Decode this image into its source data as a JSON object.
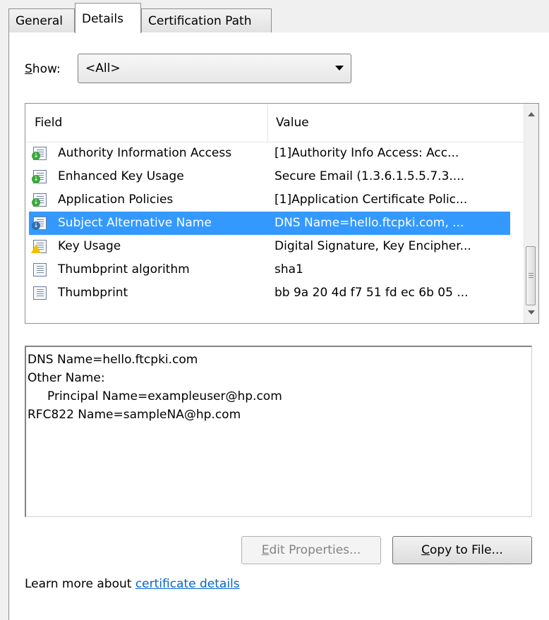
{
  "tabs": {
    "general": "General",
    "details": "Details",
    "cert_path": "Certification Path"
  },
  "show": {
    "label_underlined": "S",
    "label_rest": "how:",
    "selected": "<All>"
  },
  "list": {
    "col_field": "Field",
    "col_value": "Value",
    "rows": [
      {
        "field": "Authority Information Access",
        "value": "[1]Authority Info Access: Acc...",
        "icon": "certificate-extension-icon"
      },
      {
        "field": "Enhanced Key Usage",
        "value": "Secure Email (1.3.6.1.5.5.7.3....",
        "icon": "certificate-extension-icon"
      },
      {
        "field": "Application Policies",
        "value": "[1]Application Certificate Polic...",
        "icon": "certificate-extension-icon"
      },
      {
        "field": "Subject Alternative Name",
        "value": "DNS Name=hello.ftcpki.com, ...",
        "icon": "certificate-extension-icon"
      },
      {
        "field": "Key Usage",
        "value": "Digital Signature, Key Encipher...",
        "icon": "critical-extension-warning-icon"
      },
      {
        "field": "Thumbprint algorithm",
        "value": "sha1",
        "icon": "property-icon"
      },
      {
        "field": "Thumbprint",
        "value": "bb 9a 20 4d f7 51 fd ec 6b 05 ...",
        "icon": "property-icon"
      }
    ]
  },
  "detail_lines": [
    "DNS Name=hello.ftcpki.com",
    "Other Name:",
    "Principal Name=exampleuser@hp.com",
    "RFC822 Name=sampleNA@hp.com"
  ],
  "buttons": {
    "edit_u": "E",
    "edit_rest": "dit Properties...",
    "copy_u": "C",
    "copy_rest": "opy to File..."
  },
  "learn": {
    "prefix": "Learn more about ",
    "link": "certificate details"
  }
}
